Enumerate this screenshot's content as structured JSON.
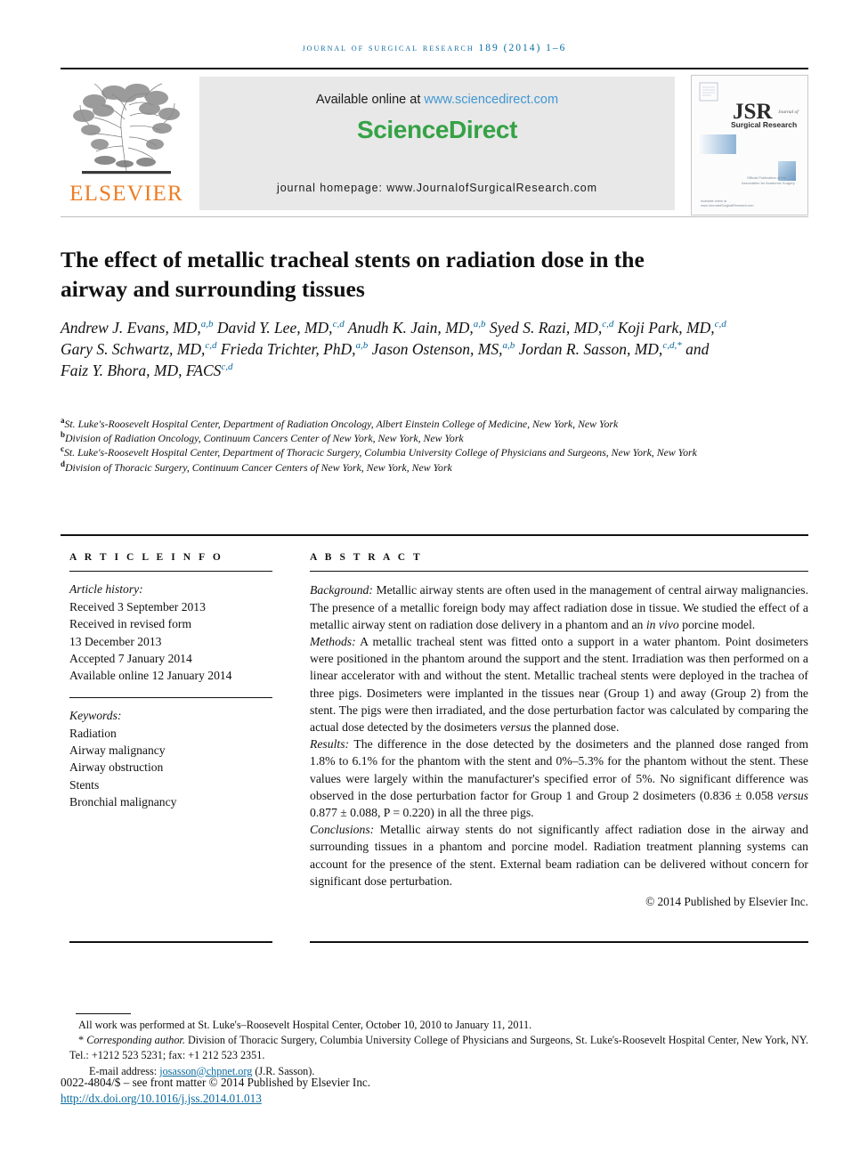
{
  "running_head": "JOURNAL OF SURGICAL RESEARCH 189 (2014) 1–6",
  "masthead": {
    "publisher": "ELSEVIER",
    "available_prefix": "Available online at ",
    "available_link": "www.sciencedirect.com",
    "brand": "ScienceDirect",
    "homepage": "journal homepage: www.JournalofSurgicalResearch.com",
    "cover": {
      "acronym": "JSR",
      "line1": "Journal of",
      "line2": "Surgical Research",
      "note1": "Official Publication of the",
      "note2": "Association for Academic Surgery",
      "footer1": "Available online at",
      "footer2": "www.JournalofSurgicalResearch.com"
    }
  },
  "article": {
    "title": "The effect of metallic tracheal stents on radiation dose in the airway and surrounding tissues",
    "authors": [
      {
        "name": "Andrew J. Evans, MD,",
        "sup": "a,b"
      },
      {
        "name": "David Y. Lee, MD,",
        "sup": "c,d"
      },
      {
        "name": "Anudh K. Jain, MD,",
        "sup": "a,b"
      },
      {
        "name": "Syed S. Razi, MD,",
        "sup": "c,d"
      },
      {
        "name": "Koji Park, MD,",
        "sup": "c,d"
      },
      {
        "name": "Gary S. Schwartz, MD,",
        "sup": "c,d"
      },
      {
        "name": "Frieda Trichter, PhD,",
        "sup": "a,b"
      },
      {
        "name": "Jason Ostenson, MS,",
        "sup": "a,b"
      },
      {
        "name": "Jordan R. Sasson, MD,",
        "sup": "c,d,*"
      },
      {
        "name": "and Faiz Y. Bhora, MD, FACS",
        "sup": "c,d"
      }
    ],
    "affiliations": [
      {
        "marker": "a",
        "text": "St. Luke's-Roosevelt Hospital Center, Department of Radiation Oncology, Albert Einstein College of Medicine, New York, New York"
      },
      {
        "marker": "b",
        "text": "Division of Radiation Oncology, Continuum Cancers Center of New York, New York, New York"
      },
      {
        "marker": "c",
        "text": "St. Luke's-Roosevelt Hospital Center, Department of Thoracic Surgery, Columbia University College of Physicians and Surgeons, New York, New York"
      },
      {
        "marker": "d",
        "text": "Division of Thoracic Surgery, Continuum Cancer Centers of New York, New York, New York"
      }
    ]
  },
  "article_info": {
    "heading": "A R T I C L E  I N F O",
    "history_label": "Article history:",
    "history": [
      "Received 3 September 2013",
      "Received in revised form",
      "13 December 2013",
      "Accepted 7 January 2014",
      "Available online 12 January 2014"
    ],
    "keywords_label": "Keywords:",
    "keywords": [
      "Radiation",
      "Airway malignancy",
      "Airway obstruction",
      "Stents",
      "Bronchial malignancy"
    ]
  },
  "abstract": {
    "heading": "A B S T R A C T",
    "sections": [
      {
        "label": "Background:",
        "text": " Metallic airway stents are often used in the management of central airway malignancies. The presence of a metallic foreign body may affect radiation dose in tissue. We studied the effect of a metallic airway stent on radiation dose delivery in a phantom and an in vivo porcine model."
      },
      {
        "label": "Methods:",
        "text": " A metallic tracheal stent was fitted onto a support in a water phantom. Point dosimeters were positioned in the phantom around the support and the stent. Irradiation was then performed on a linear accelerator with and without the stent. Metallic tracheal stents were deployed in the trachea of three pigs. Dosimeters were implanted in the tissues near (Group 1) and away (Group 2) from the stent. The pigs were then irradiated, and the dose perturbation factor was calculated by comparing the actual dose detected by the dosimeters versus the planned dose."
      },
      {
        "label": "Results:",
        "text": " The difference in the dose detected by the dosimeters and the planned dose ranged from 1.8% to 6.1% for the phantom with the stent and 0%–5.3% for the phantom without the stent. These values were largely within the manufacturer's specified error of 5%. No significant difference was observed in the dose perturbation factor for Group 1 and Group 2 dosimeters (0.836 ± 0.058 versus 0.877 ± 0.088, P = 0.220) in all the three pigs."
      },
      {
        "label": "Conclusions:",
        "text": " Metallic airway stents do not significantly affect radiation dose in the airway and surrounding tissues in a phantom and porcine model. Radiation treatment planning systems can account for the presence of the stent. External beam radiation can be delivered without concern for significant dose perturbation."
      }
    ],
    "copyright": "© 2014 Published by Elsevier Inc."
  },
  "footnotes": {
    "work_note": "All work was performed at St. Luke's–Roosevelt Hospital Center, October 10, 2010 to January 11, 2011.",
    "corresponding_marker": "*",
    "corresponding_label": "Corresponding author.",
    "corresponding_text": " Division of Thoracic Surgery, Columbia University College of Physicians and Surgeons, St. Luke's-Roosevelt Hospital Center, New York, NY. Tel.: +1212 523 5231; fax: +1 212 523 2351.",
    "email_label": "E-mail address: ",
    "email": "josasson@chpnet.org",
    "email_suffix": " (J.R. Sasson).",
    "issn_line": "0022-4804/$ – see front matter © 2014 Published by Elsevier Inc.",
    "doi": "http://dx.doi.org/10.1016/j.jss.2014.01.013"
  },
  "colors": {
    "link_blue": "#0b6ba0",
    "sciencedirect_green": "#35a245",
    "elsevier_orange": "#ef7c22",
    "banner_gray": "#e8e8e8"
  }
}
